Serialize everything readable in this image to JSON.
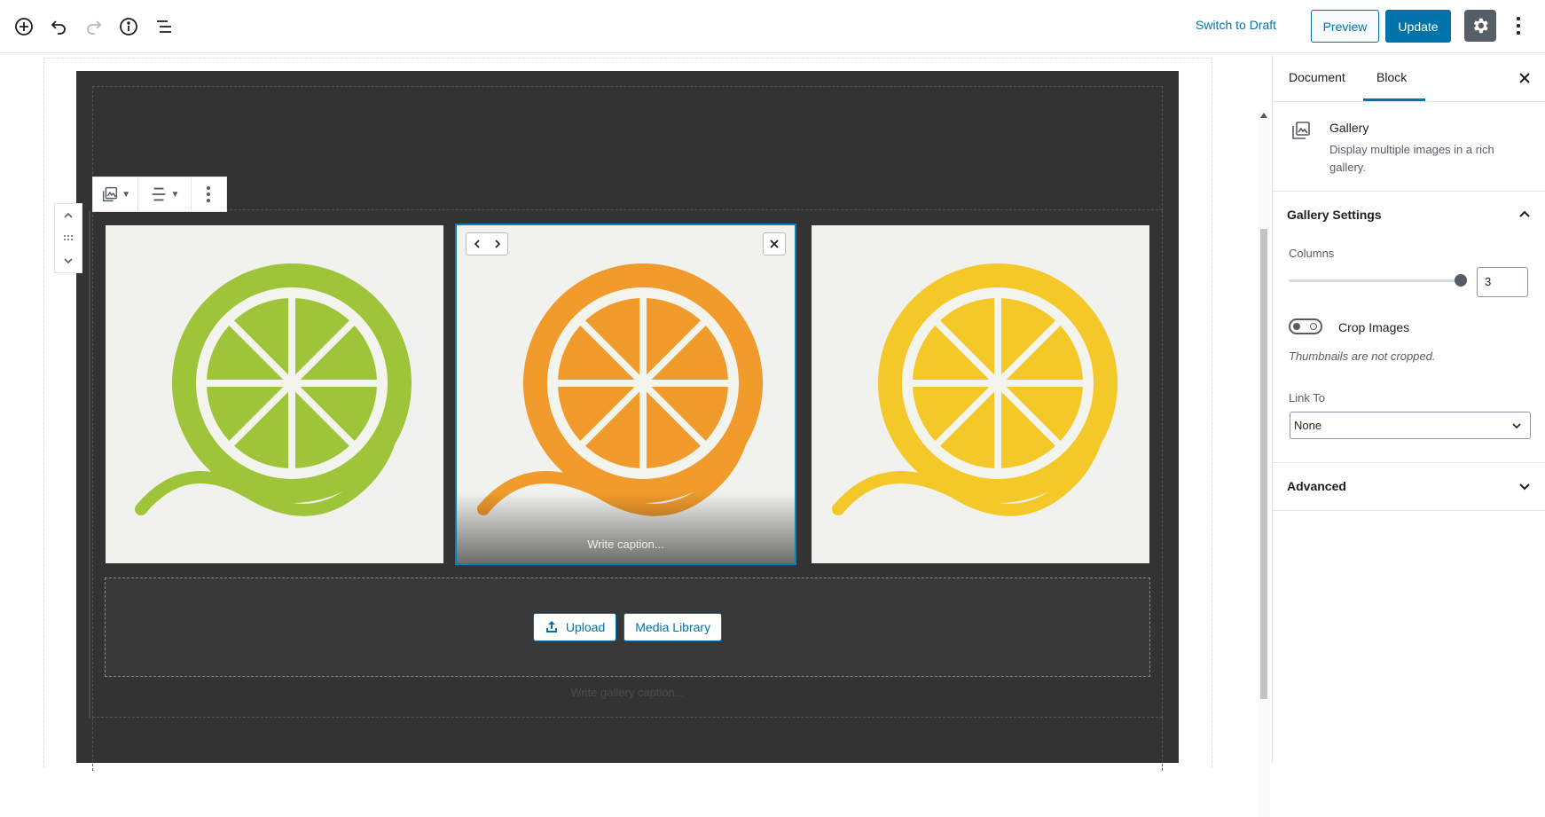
{
  "topbar": {
    "switch_draft": "Switch to Draft",
    "preview": "Preview",
    "update": "Update",
    "icons": [
      "add-block-icon",
      "undo-icon",
      "redo-icon",
      "info-icon",
      "outline-icon",
      "gear-icon",
      "more-icon"
    ]
  },
  "gallery": {
    "images": [
      {
        "color": "#9ec53a",
        "selected": false
      },
      {
        "color": "#f19b2c",
        "selected": true,
        "caption_placeholder": "Write caption..."
      },
      {
        "color": "#f5c829",
        "selected": false
      }
    ],
    "upload": "Upload",
    "media_library": "Media Library",
    "gallery_caption_placeholder": "Write gallery caption..."
  },
  "sidebar": {
    "tabs": [
      {
        "label": "Document",
        "active": false
      },
      {
        "label": "Block",
        "active": true
      }
    ],
    "block": {
      "title": "Gallery",
      "description": "Display multiple images in a rich gallery."
    },
    "gallery_settings": {
      "title": "Gallery Settings",
      "columns_label": "Columns",
      "columns_value": "3",
      "crop_label": "Crop Images",
      "crop_help": "Thumbnails are not cropped.",
      "link_to_label": "Link To",
      "link_to_value": "None"
    },
    "advanced": "Advanced"
  },
  "colors": {
    "accent": "#0073aa",
    "selection": "#0085ba",
    "dark_bg": "#333333"
  }
}
